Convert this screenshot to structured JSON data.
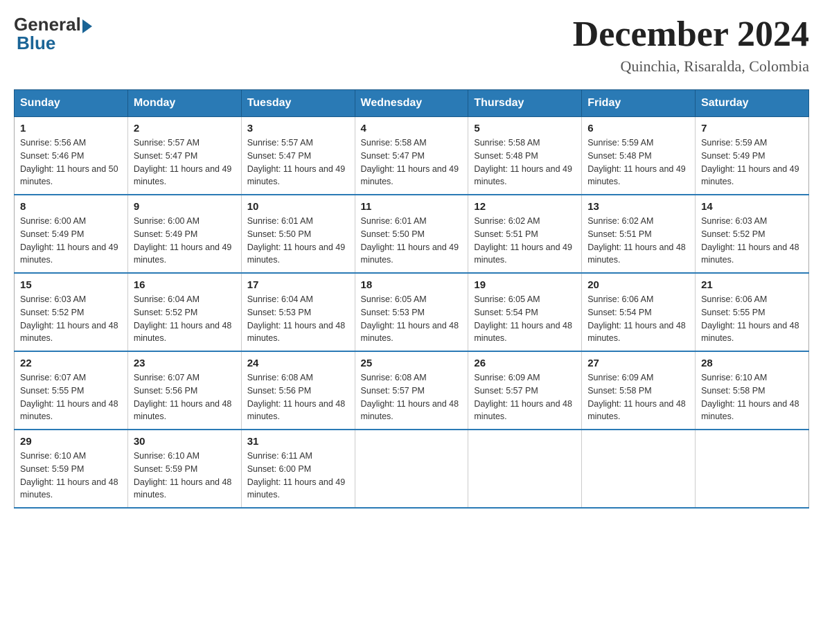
{
  "logo": {
    "general": "General",
    "blue": "Blue"
  },
  "title": "December 2024",
  "subtitle": "Quinchia, Risaralda, Colombia",
  "headers": [
    "Sunday",
    "Monday",
    "Tuesday",
    "Wednesday",
    "Thursday",
    "Friday",
    "Saturday"
  ],
  "weeks": [
    [
      {
        "day": "1",
        "sunrise": "5:56 AM",
        "sunset": "5:46 PM",
        "daylight": "11 hours and 50 minutes."
      },
      {
        "day": "2",
        "sunrise": "5:57 AM",
        "sunset": "5:47 PM",
        "daylight": "11 hours and 49 minutes."
      },
      {
        "day": "3",
        "sunrise": "5:57 AM",
        "sunset": "5:47 PM",
        "daylight": "11 hours and 49 minutes."
      },
      {
        "day": "4",
        "sunrise": "5:58 AM",
        "sunset": "5:47 PM",
        "daylight": "11 hours and 49 minutes."
      },
      {
        "day": "5",
        "sunrise": "5:58 AM",
        "sunset": "5:48 PM",
        "daylight": "11 hours and 49 minutes."
      },
      {
        "day": "6",
        "sunrise": "5:59 AM",
        "sunset": "5:48 PM",
        "daylight": "11 hours and 49 minutes."
      },
      {
        "day": "7",
        "sunrise": "5:59 AM",
        "sunset": "5:49 PM",
        "daylight": "11 hours and 49 minutes."
      }
    ],
    [
      {
        "day": "8",
        "sunrise": "6:00 AM",
        "sunset": "5:49 PM",
        "daylight": "11 hours and 49 minutes."
      },
      {
        "day": "9",
        "sunrise": "6:00 AM",
        "sunset": "5:49 PM",
        "daylight": "11 hours and 49 minutes."
      },
      {
        "day": "10",
        "sunrise": "6:01 AM",
        "sunset": "5:50 PM",
        "daylight": "11 hours and 49 minutes."
      },
      {
        "day": "11",
        "sunrise": "6:01 AM",
        "sunset": "5:50 PM",
        "daylight": "11 hours and 49 minutes."
      },
      {
        "day": "12",
        "sunrise": "6:02 AM",
        "sunset": "5:51 PM",
        "daylight": "11 hours and 49 minutes."
      },
      {
        "day": "13",
        "sunrise": "6:02 AM",
        "sunset": "5:51 PM",
        "daylight": "11 hours and 48 minutes."
      },
      {
        "day": "14",
        "sunrise": "6:03 AM",
        "sunset": "5:52 PM",
        "daylight": "11 hours and 48 minutes."
      }
    ],
    [
      {
        "day": "15",
        "sunrise": "6:03 AM",
        "sunset": "5:52 PM",
        "daylight": "11 hours and 48 minutes."
      },
      {
        "day": "16",
        "sunrise": "6:04 AM",
        "sunset": "5:52 PM",
        "daylight": "11 hours and 48 minutes."
      },
      {
        "day": "17",
        "sunrise": "6:04 AM",
        "sunset": "5:53 PM",
        "daylight": "11 hours and 48 minutes."
      },
      {
        "day": "18",
        "sunrise": "6:05 AM",
        "sunset": "5:53 PM",
        "daylight": "11 hours and 48 minutes."
      },
      {
        "day": "19",
        "sunrise": "6:05 AM",
        "sunset": "5:54 PM",
        "daylight": "11 hours and 48 minutes."
      },
      {
        "day": "20",
        "sunrise": "6:06 AM",
        "sunset": "5:54 PM",
        "daylight": "11 hours and 48 minutes."
      },
      {
        "day": "21",
        "sunrise": "6:06 AM",
        "sunset": "5:55 PM",
        "daylight": "11 hours and 48 minutes."
      }
    ],
    [
      {
        "day": "22",
        "sunrise": "6:07 AM",
        "sunset": "5:55 PM",
        "daylight": "11 hours and 48 minutes."
      },
      {
        "day": "23",
        "sunrise": "6:07 AM",
        "sunset": "5:56 PM",
        "daylight": "11 hours and 48 minutes."
      },
      {
        "day": "24",
        "sunrise": "6:08 AM",
        "sunset": "5:56 PM",
        "daylight": "11 hours and 48 minutes."
      },
      {
        "day": "25",
        "sunrise": "6:08 AM",
        "sunset": "5:57 PM",
        "daylight": "11 hours and 48 minutes."
      },
      {
        "day": "26",
        "sunrise": "6:09 AM",
        "sunset": "5:57 PM",
        "daylight": "11 hours and 48 minutes."
      },
      {
        "day": "27",
        "sunrise": "6:09 AM",
        "sunset": "5:58 PM",
        "daylight": "11 hours and 48 minutes."
      },
      {
        "day": "28",
        "sunrise": "6:10 AM",
        "sunset": "5:58 PM",
        "daylight": "11 hours and 48 minutes."
      }
    ],
    [
      {
        "day": "29",
        "sunrise": "6:10 AM",
        "sunset": "5:59 PM",
        "daylight": "11 hours and 48 minutes."
      },
      {
        "day": "30",
        "sunrise": "6:10 AM",
        "sunset": "5:59 PM",
        "daylight": "11 hours and 48 minutes."
      },
      {
        "day": "31",
        "sunrise": "6:11 AM",
        "sunset": "6:00 PM",
        "daylight": "11 hours and 49 minutes."
      },
      null,
      null,
      null,
      null
    ]
  ]
}
